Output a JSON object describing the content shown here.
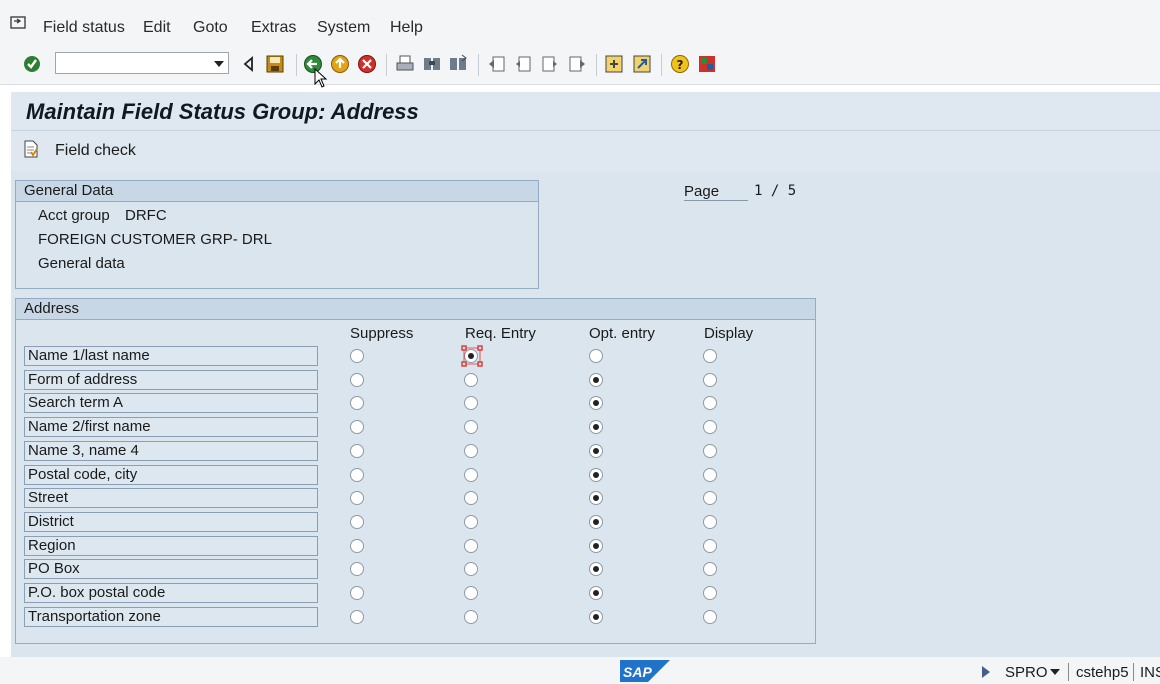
{
  "menu": {
    "items": [
      {
        "label": "Field status"
      },
      {
        "label": "Edit"
      },
      {
        "label": "Goto"
      },
      {
        "label": "Extras"
      },
      {
        "label": "System"
      },
      {
        "label": "Help"
      }
    ]
  },
  "toolbar": {
    "command_field_value": "",
    "icons": [
      "enter-icon",
      "back-triangle-icon",
      "save-icon",
      "back-icon",
      "exit-icon",
      "cancel-icon",
      "print-icon",
      "find-icon",
      "find-next-icon",
      "first-page-icon",
      "previous-page-icon",
      "next-page-icon",
      "last-page-icon",
      "create-session-icon",
      "shortcut-icon",
      "help-icon",
      "customize-layout-icon"
    ]
  },
  "title": "Maintain Field Status Group: Address",
  "app_toolbar": {
    "field_check_label": "Field check"
  },
  "general_data": {
    "title": "General Data",
    "acct_group_label": "Acct group",
    "acct_group_value": "DRFC",
    "description": "FOREIGN CUSTOMER GRP- DRL",
    "subgroup": "General data"
  },
  "page": {
    "label": "Page",
    "current": "1",
    "separator": "/",
    "total": "5"
  },
  "address": {
    "title": "Address",
    "columns": [
      "Suppress",
      "Req. Entry",
      "Opt. entry",
      "Display"
    ],
    "rows": [
      {
        "label": "Name 1/last name",
        "selected": 1
      },
      {
        "label": "Form of address",
        "selected": 2
      },
      {
        "label": "Search term A",
        "selected": 2
      },
      {
        "label": "Name 2/first name",
        "selected": 2
      },
      {
        "label": "Name 3, name 4",
        "selected": 2
      },
      {
        "label": "Postal code, city",
        "selected": 2
      },
      {
        "label": "Street",
        "selected": 2
      },
      {
        "label": "District",
        "selected": 2
      },
      {
        "label": "Region",
        "selected": 2
      },
      {
        "label": "PO Box",
        "selected": 2
      },
      {
        "label": "P.O. box postal code",
        "selected": 2
      },
      {
        "label": "Transportation zone",
        "selected": 2
      }
    ]
  },
  "statusbar": {
    "logo": "SAP",
    "transaction": "SPRO",
    "server": "cstehp5",
    "mode": "INS"
  },
  "colors": {
    "title_band": "#dfe8f1",
    "content_bg": "#dbe5ee",
    "group_header": "#c8d7e6",
    "focus_marker": "#d9352f"
  }
}
